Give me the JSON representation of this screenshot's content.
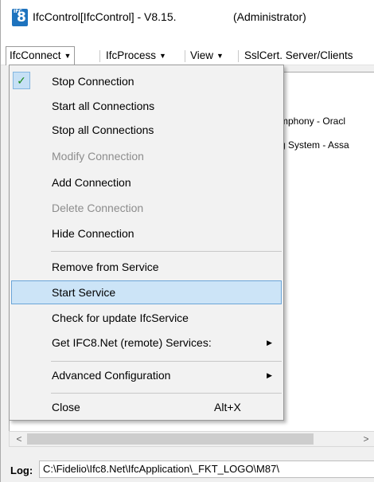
{
  "window": {
    "app_icon_text": "8",
    "title": "IfcControl[IfcControl] - V8.15.",
    "title_suffix": "(Administrator)"
  },
  "menubar": {
    "items": [
      {
        "label": "IfcConnect",
        "active": true
      },
      {
        "label": "IfcProcess"
      },
      {
        "label": "View"
      },
      {
        "label": "SslCert. Server/Clients"
      }
    ]
  },
  "background": {
    "items": [
      {
        "label": "mphony - Oracl"
      },
      {
        "label": "g System - Assa"
      }
    ]
  },
  "dropdown": {
    "items": [
      {
        "label": "Stop Connection",
        "checked": true
      },
      {
        "label": "Start all Connections"
      },
      {
        "label": "Stop all Connections"
      },
      {
        "label": "Modify Connection",
        "disabled": true
      },
      {
        "label": "Add Connection"
      },
      {
        "label": "Delete Connection",
        "disabled": true
      },
      {
        "label": "Hide Connection"
      },
      {
        "label": "Remove from Service"
      },
      {
        "label": "Start Service",
        "highlighted": true
      },
      {
        "label": "Check for update IfcService"
      },
      {
        "label": "Get IFC8.Net (remote) Services:",
        "submenu": true
      },
      {
        "label": "Advanced Configuration",
        "submenu": true
      },
      {
        "label": "Close",
        "shortcut": "Alt+X"
      }
    ]
  },
  "log": {
    "label": "Log:",
    "path": "C:\\Fidelio\\Ifc8.Net\\IfcApplication\\_FKT_LOGO\\M87\\"
  },
  "icons": {
    "check": "check-icon",
    "submenu": "chevron-right-icon",
    "scroll_left": "scroll-left-icon",
    "scroll_right": "scroll-right-icon",
    "caret": "caret-down-icon"
  },
  "colors": {
    "highlight_bg": "#cce4f7",
    "highlight_border": "#6aa5d8",
    "disabled_text": "#8d8d8d",
    "app_icon": "#1e73be"
  }
}
